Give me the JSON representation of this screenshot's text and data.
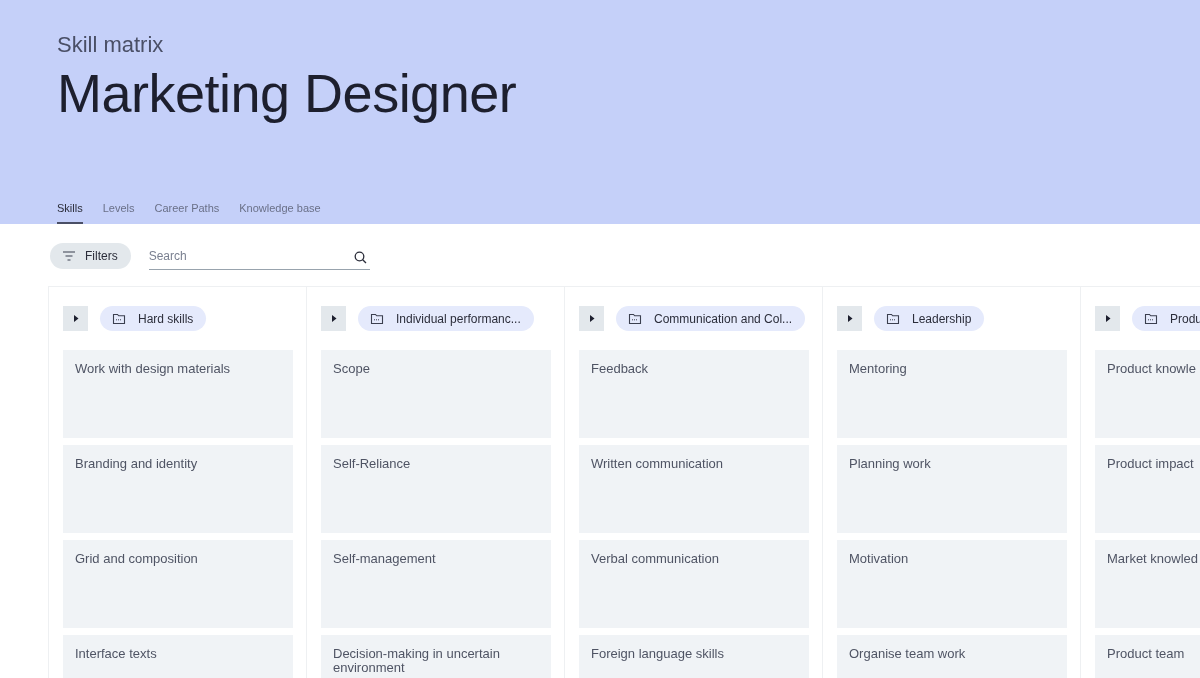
{
  "header": {
    "eyebrow": "Skill matrix",
    "title": "Marketing Designer"
  },
  "tabs": [
    {
      "label": "Skills",
      "selected": true
    },
    {
      "label": "Levels",
      "selected": false
    },
    {
      "label": "Career Paths",
      "selected": false
    },
    {
      "label": "Knowledge base",
      "selected": false
    }
  ],
  "toolbar": {
    "filters": "Filters",
    "search": {
      "placeholder": "Search"
    }
  },
  "columns": [
    {
      "group": "Hard skills",
      "expanded": false,
      "skills": [
        "Work with design materials",
        "Branding and identity",
        "Grid and composition",
        "Interface texts"
      ]
    },
    {
      "group": "Individual performanc...",
      "expanded": false,
      "skills": [
        "Scope",
        "Self-Reliance",
        "Self-management",
        "Decision-making in uncertain environment"
      ]
    },
    {
      "group": "Communication and Col...",
      "expanded": false,
      "skills": [
        "Feedback",
        "Written communication",
        "Verbal communication",
        "Foreign language skills"
      ]
    },
    {
      "group": "Leadership",
      "expanded": false,
      "skills": [
        "Mentoring",
        "Planning work",
        "Motivation",
        "Organise team work"
      ]
    },
    {
      "group": "Produ",
      "expanded": false,
      "skills": [
        "Product knowle",
        "Product impact",
        "Market knowled",
        "Product team"
      ]
    }
  ]
}
